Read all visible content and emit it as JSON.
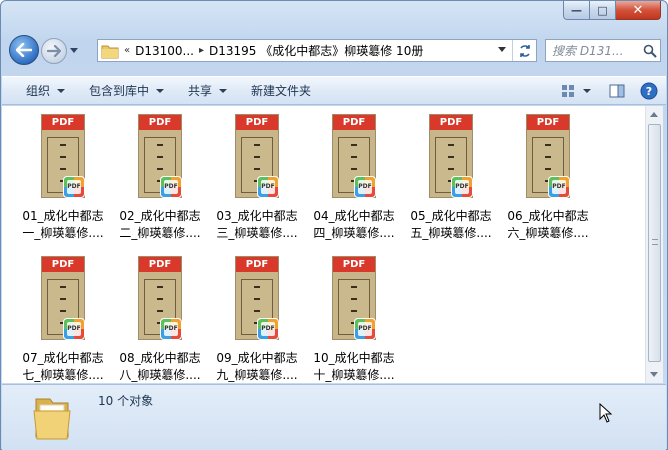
{
  "window": {
    "caption": {
      "minimize": "—",
      "maximize": "□",
      "close": "✕"
    }
  },
  "nav": {
    "breadcrumb": {
      "prefix": "«",
      "segment1": "D13100...",
      "separator": "▸",
      "segment2": "D13195 《成化中都志》柳瑛簒修 10册"
    },
    "search_placeholder": "搜索 D131...",
    "icons": {
      "back": "back-arrow-icon",
      "forward": "forward-arrow-icon",
      "refresh": "refresh-icon",
      "search": "search-icon",
      "folder": "folder-icon"
    }
  },
  "toolbar": {
    "organize": "组织",
    "include_in_library": "包含到库中",
    "share": "共享",
    "new_folder": "新建文件夹",
    "icons": {
      "view": "view-options-icon",
      "preview_pane": "preview-pane-icon",
      "help": "help-icon"
    }
  },
  "files": [
    {
      "line1": "01_成化中都志",
      "line2": "一_柳瑛簒修...."
    },
    {
      "line1": "02_成化中都志",
      "line2": "二_柳瑛簒修...."
    },
    {
      "line1": "03_成化中都志",
      "line2": "三_柳瑛簒修...."
    },
    {
      "line1": "04_成化中都志",
      "line2": "四_柳瑛簒修...."
    },
    {
      "line1": "05_成化中都志",
      "line2": "五_柳瑛簒修...."
    },
    {
      "line1": "06_成化中都志",
      "line2": "六_柳瑛簒修...."
    },
    {
      "line1": "07_成化中都志",
      "line2": "七_柳瑛簒修...."
    },
    {
      "line1": "08_成化中都志",
      "line2": "八_柳瑛簒修...."
    },
    {
      "line1": "09_成化中都志",
      "line2": "九_柳瑛簒修...."
    },
    {
      "line1": "10_成化中都志",
      "line2": "十_柳瑛簒修...."
    }
  ],
  "file_badge": "PDF",
  "status": {
    "count": "10 个对象"
  },
  "colors": {
    "pdf_band": "#d8392b",
    "toolbar_text": "#1e3550"
  }
}
